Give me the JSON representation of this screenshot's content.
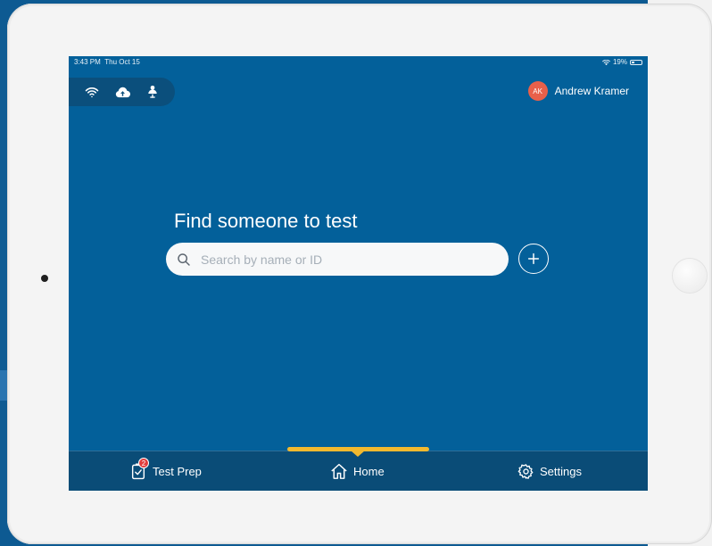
{
  "status_bar": {
    "time": "3:43 PM",
    "date": "Thu Oct 15",
    "battery": "19%",
    "battery_level": 0.19
  },
  "toolbar": {
    "icons": [
      "wifi-icon",
      "cloud-upload-icon",
      "user-sync-icon"
    ]
  },
  "user": {
    "initials": "AK",
    "name": "Andrew Kramer",
    "avatar_color": "#e8604a"
  },
  "main": {
    "headline": "Find someone to test"
  },
  "search": {
    "placeholder": "Search by name or ID",
    "value": ""
  },
  "tabs": [
    {
      "label": "Test Prep",
      "badge": "2",
      "icon": "clipboard-check-icon"
    },
    {
      "label": "Home",
      "icon": "home-icon",
      "selected": true
    },
    {
      "label": "Settings",
      "icon": "gear-icon"
    }
  ],
  "colors": {
    "screen_bg": "#03609a",
    "tab_bar": "#0a4c77",
    "accent": "#f2b92f",
    "badge": "#e23c3c"
  }
}
